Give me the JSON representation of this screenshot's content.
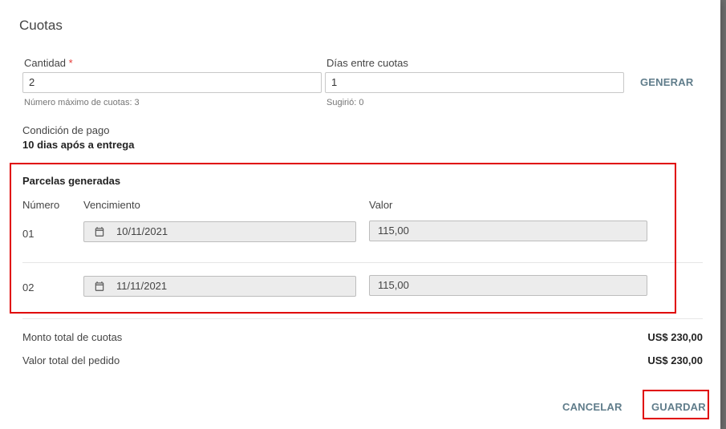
{
  "dialog": {
    "title": "Cuotas",
    "cantidad": {
      "label": "Cantidad",
      "required_mark": "*",
      "value": "2",
      "hint": "Número máximo de cuotas: 3"
    },
    "dias": {
      "label": "Días entre cuotas",
      "value": "1",
      "hint": "Sugirió: 0"
    },
    "generar_label": "GENERAR",
    "condicion": {
      "label": "Condición de pago",
      "value": "10 dias após a entrega"
    },
    "parcelas": {
      "title": "Parcelas generadas",
      "headers": {
        "numero": "Número",
        "vencimiento": "Vencimiento",
        "valor": "Valor"
      },
      "rows": [
        {
          "numero": "01",
          "vencimiento": "10/11/2021",
          "valor": "115,00"
        },
        {
          "numero": "02",
          "vencimiento": "11/11/2021",
          "valor": "115,00"
        }
      ]
    },
    "totals": {
      "monto_label": "Monto total de cuotas",
      "monto_value": "US$ 230,00",
      "pedido_label": "Valor total del pedido",
      "pedido_value": "US$ 230,00"
    },
    "actions": {
      "cancel_label": "CANCELAR",
      "save_label": "GUARDAR"
    }
  },
  "colors": {
    "accent": "#607d8b",
    "highlight": "#e00000",
    "required": "#e53935"
  },
  "icons": {
    "calendar": "calendar-icon"
  }
}
